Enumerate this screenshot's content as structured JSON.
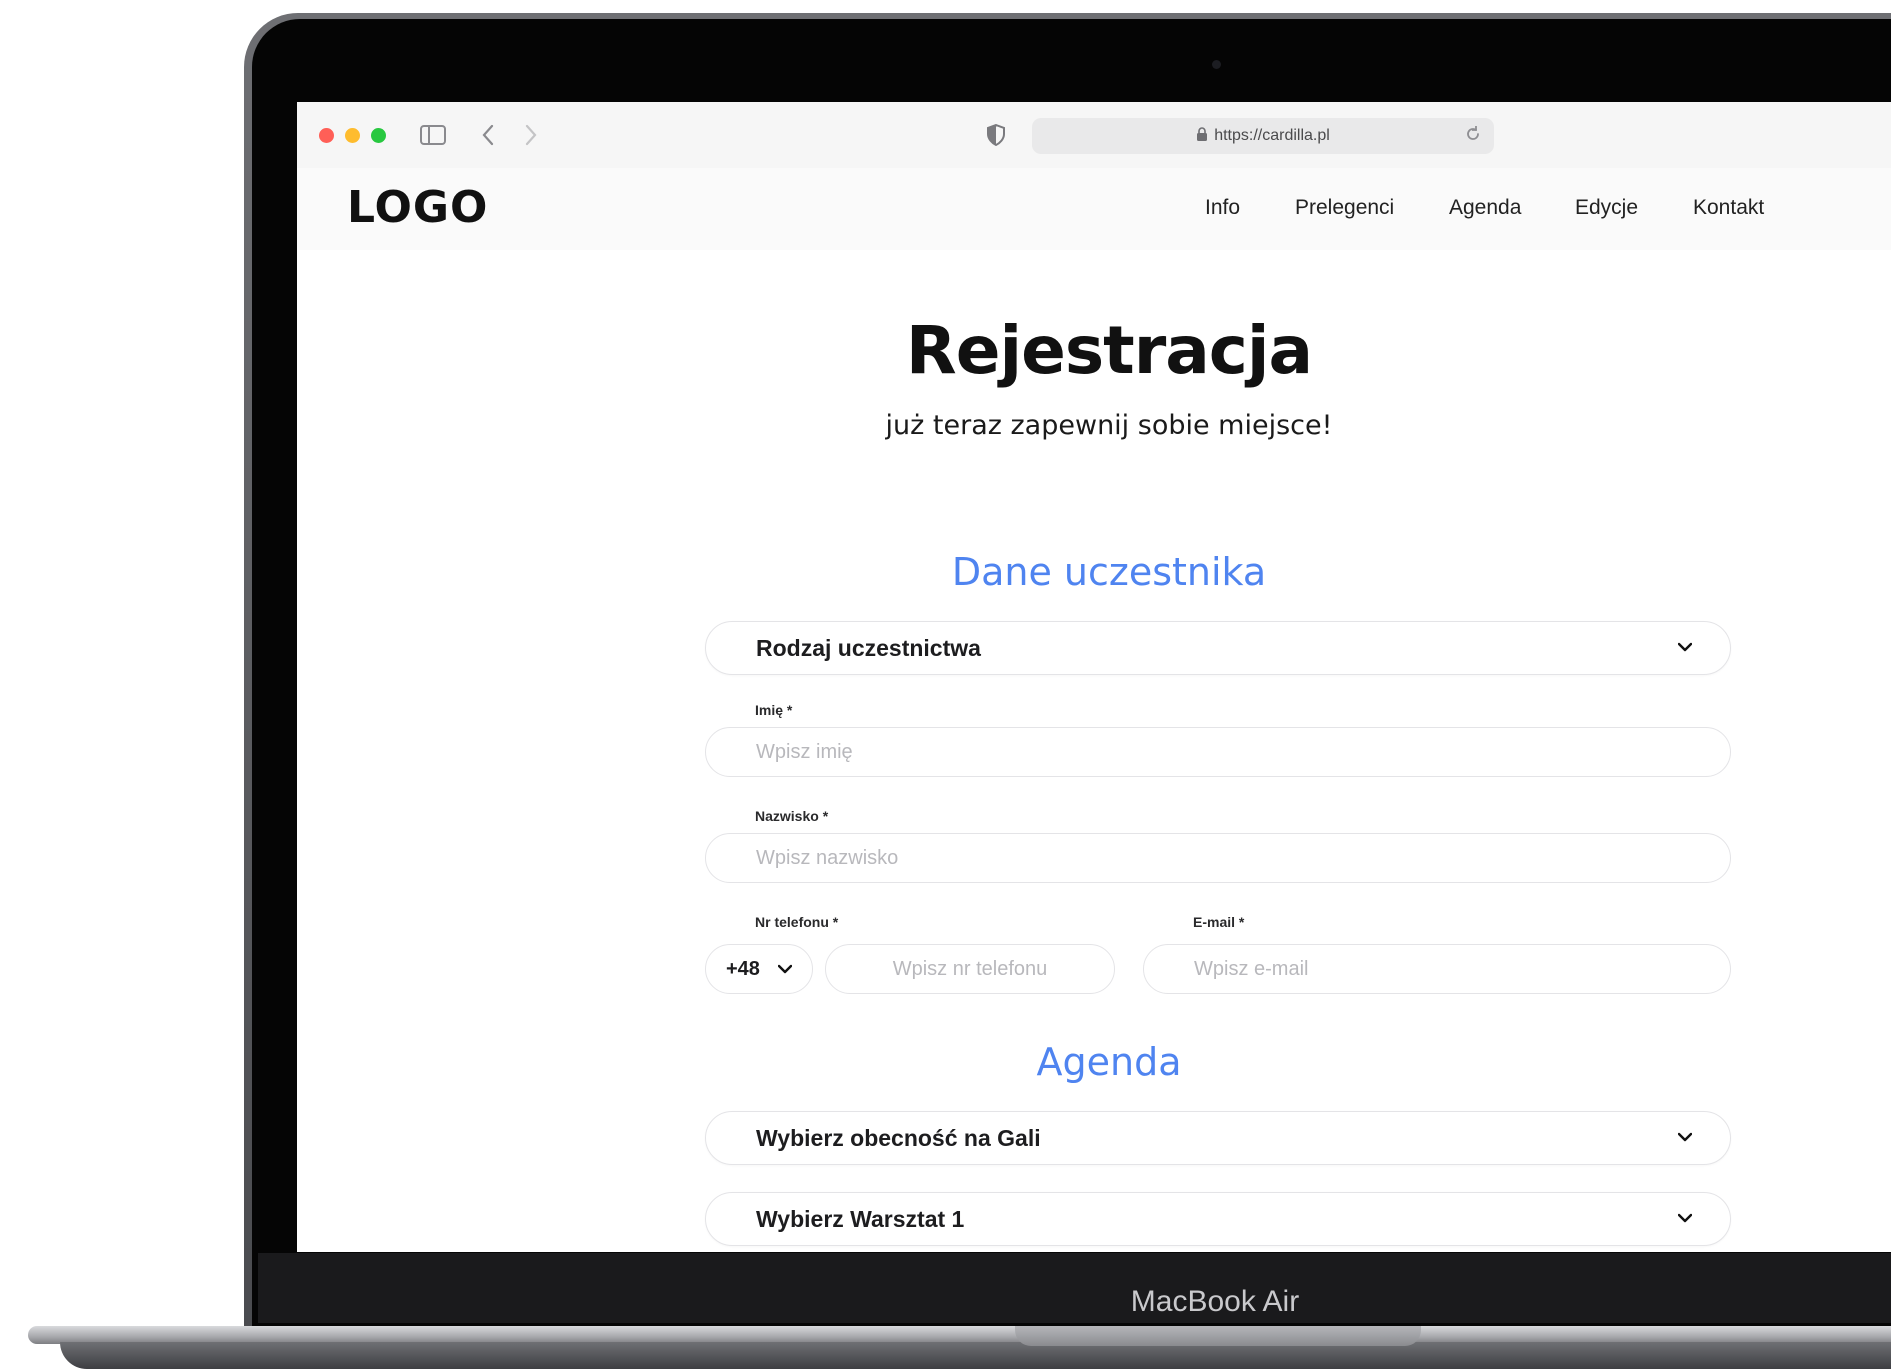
{
  "device": {
    "label": "MacBook Air"
  },
  "browser": {
    "url": "https://cardilla.pl",
    "icons": [
      "sidebar-icon",
      "back-icon",
      "forward-icon",
      "shield-icon",
      "lock-icon",
      "reload-icon"
    ]
  },
  "header": {
    "logo": "LOGO",
    "nav": [
      "Info",
      "Prelegenci",
      "Agenda",
      "Edycje",
      "Kontakt"
    ]
  },
  "hero": {
    "title": "Rejestracja",
    "subtitle": "już teraz zapewnij sobie miejsce!"
  },
  "participant": {
    "section_title": "Dane uczestnika",
    "participation_select": "Rodzaj uczestnictwa",
    "first_name": {
      "label": "Imię *",
      "placeholder": "Wpisz imię"
    },
    "last_name": {
      "label": "Nazwisko *",
      "placeholder": "Wpisz nazwisko"
    },
    "phone": {
      "label": "Nr telefonu *",
      "prefix": "+48",
      "placeholder": "Wpisz nr telefonu"
    },
    "email": {
      "label": "E-mail *",
      "placeholder": "Wpisz e-mail"
    }
  },
  "agenda": {
    "section_title": "Agenda",
    "gala_select": "Wybierz obecność na Gali",
    "workshop_select": "Wybierz Warsztat 1"
  },
  "colors": {
    "accent": "#4f84f0",
    "text": "#111111",
    "border": "#e4e4e7"
  }
}
